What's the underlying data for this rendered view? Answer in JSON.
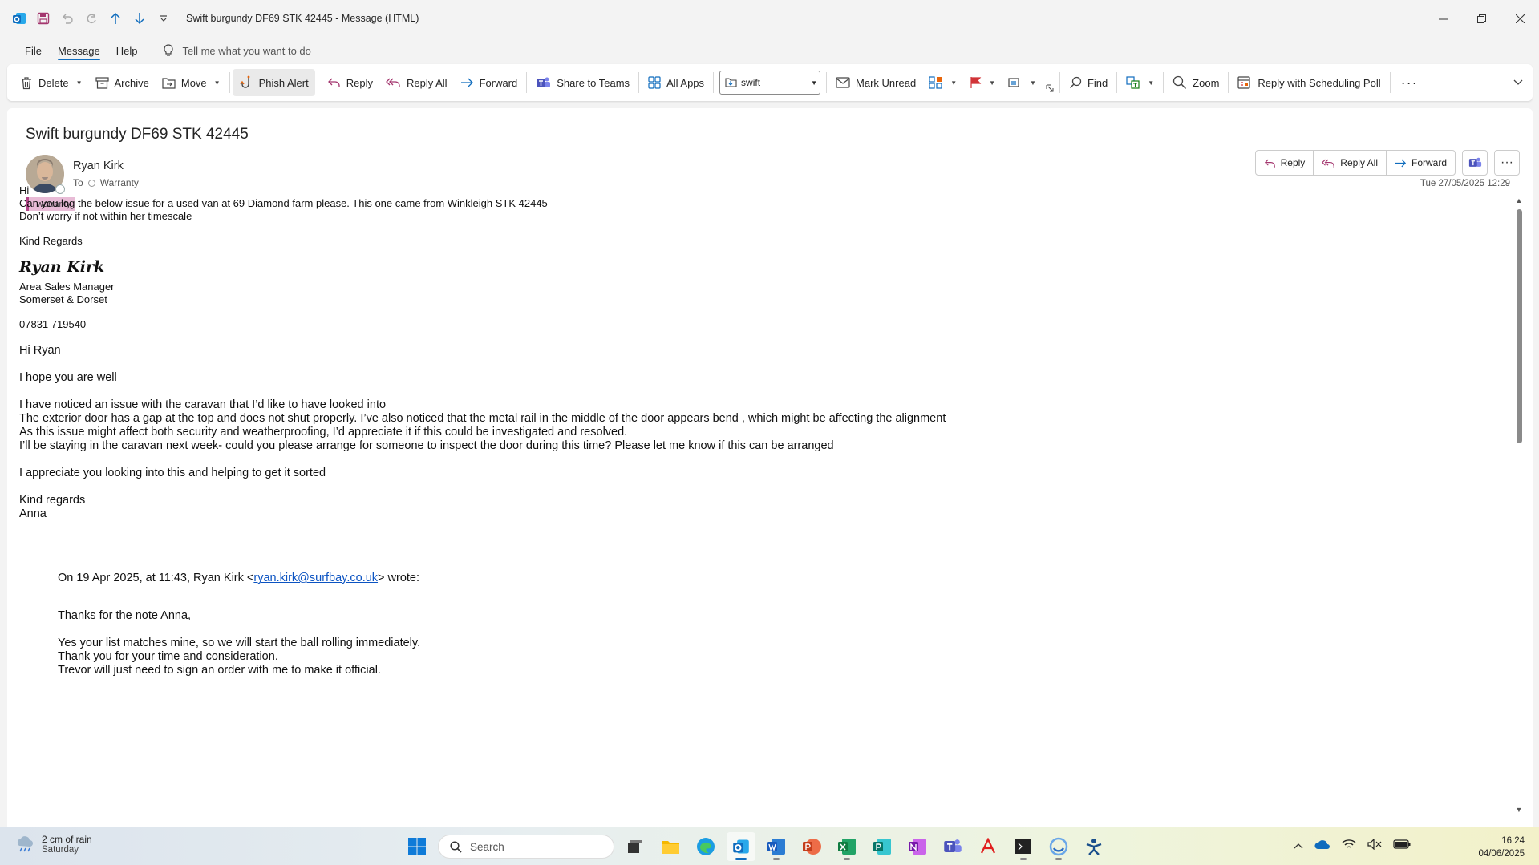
{
  "window": {
    "title": "Swift burgundy DF69 STK 42445  -  Message (HTML)"
  },
  "menu": {
    "items": [
      "File",
      "Message",
      "Help"
    ],
    "tellme": "Tell me what you want to do"
  },
  "ribbon": {
    "delete": "Delete",
    "archive": "Archive",
    "move": "Move",
    "phish": "Phish Alert",
    "reply": "Reply",
    "reply_all": "Reply All",
    "forward": "Forward",
    "share_teams": "Share to Teams",
    "all_apps": "All Apps",
    "search_value": "swift",
    "mark_unread": "Mark Unread",
    "find": "Find",
    "zoom": "Zoom",
    "scheduling_poll": "Reply with Scheduling Poll"
  },
  "message": {
    "subject": "Swift burgundy DF69 STK 42445",
    "sender": "Ryan Kirk",
    "to_label": "To",
    "to": "Warranty",
    "tag": "warranty",
    "datetime": "Tue 27/05/2025 12:29",
    "actions": {
      "reply": "Reply",
      "reply_all": "Reply All",
      "forward": "Forward"
    },
    "body": {
      "greeting": "Hi",
      "p1": "Can you log the below issue for a used van at 69 Diamond farm please. This one came from Winkleigh STK 42445",
      "p2": "Don’t worry if not within her timescale",
      "regards": "Kind Regards",
      "sig_name": "Ryan Kirk",
      "sig_title": "Area Sales Manager",
      "sig_region": "Somerset & Dorset",
      "sig_phone": "07831 719540",
      "q_greeting": "Hi Ryan",
      "q_hope": "I hope you are well",
      "q_l1": "I have noticed an issue with the caravan that I’d like to have looked into",
      "q_l2": "The exterior door has a gap at the top and does not shut properly. I’ve also noticed that the metal rail in the middle of the door appears bend , which might be affecting the alignment",
      "q_l3": "As this issue might affect both security and weatherproofing, I’d appreciate it if this could be investigated and resolved.",
      "q_l4": "I’ll be staying in the caravan next week- could you please arrange for someone to inspect the door during this time? Please let me know if this can be arranged",
      "q_appreciate": "I appreciate you looking into this and helping to get it sorted",
      "q_regards": "Kind regards",
      "q_name": "Anna",
      "on_prefix": "On 19 Apr 2025, at 11:43, Ryan Kirk <",
      "on_email": "ryan.kirk@surfbay.co.uk",
      "on_suffix": "> wrote:",
      "r_l1": "Thanks for the note Anna,",
      "r_l2": "Yes your list matches mine, so we will start the ball rolling immediately.",
      "r_l3": "Thank you for your time and consideration.",
      "r_l4": "Trevor will just need to sign an order with me to make it official."
    }
  },
  "taskbar": {
    "weather_line1": "2 cm of rain",
    "weather_line2": "Saturday",
    "search": "Search",
    "time": "16:24",
    "date": "04/06/2025"
  },
  "colors": {
    "accent": "#0f6cbd",
    "tag_bg": "#e8bbd6",
    "tag_bar": "#b4458a",
    "link": "#0b53c2"
  }
}
